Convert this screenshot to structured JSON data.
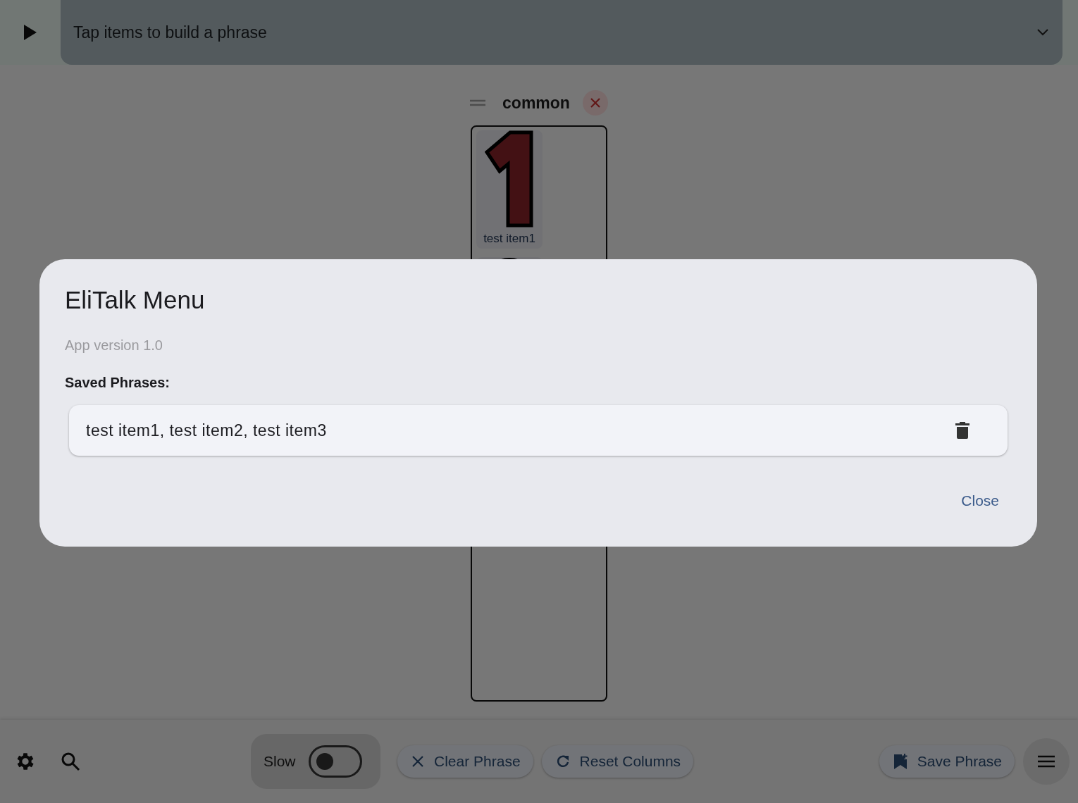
{
  "phrase_bar": {
    "placeholder": "Tap items to build a phrase"
  },
  "columns": [
    {
      "title": "common",
      "items": [
        {
          "label": "test item1"
        }
      ]
    }
  ],
  "bottom_bar": {
    "slow_toggle": {
      "label": "Slow",
      "on": false
    },
    "buttons": [
      {
        "label": "Clear Phrase",
        "kind": "clear"
      },
      {
        "label": "Reset Columns",
        "kind": "reset"
      }
    ],
    "save_button": "Save Phrase"
  },
  "dialog": {
    "title": "EliTalk Menu",
    "version": "App version 1.0",
    "section_label": "Saved Phrases:",
    "saved_phrases": [
      "test item1, test item2, test item3"
    ],
    "close_button": "Close"
  }
}
